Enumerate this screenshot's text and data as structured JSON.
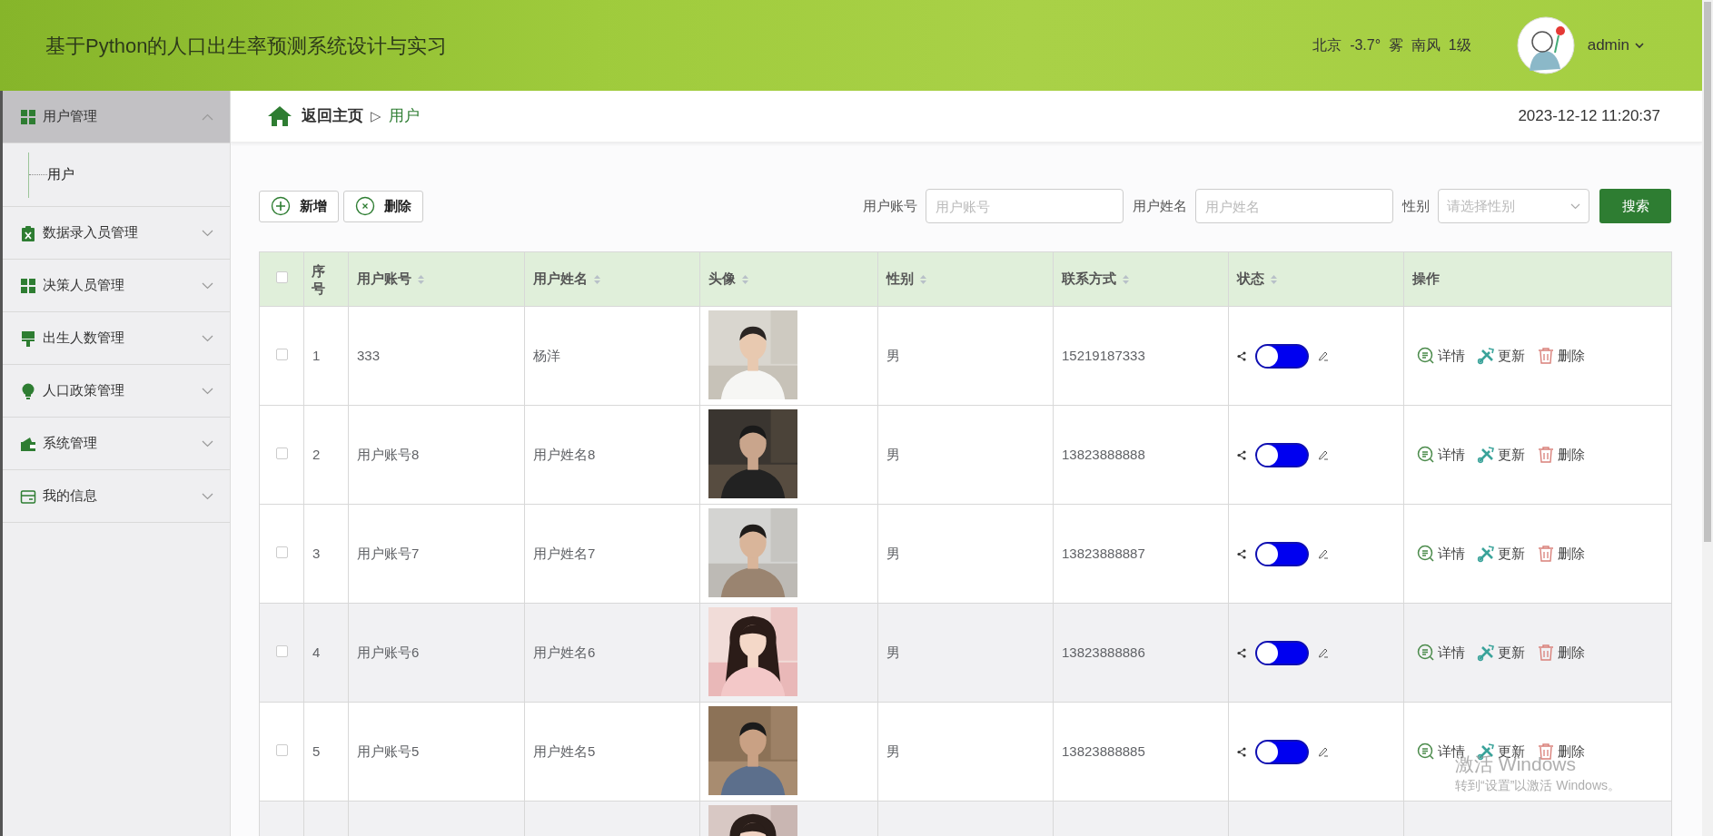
{
  "header": {
    "title": "基于Python的人口出生率预测系统设计与实习",
    "weather": "北京  -3.7°  雾  南风  1级",
    "user": "admin"
  },
  "sidebar": {
    "items": [
      {
        "label": "用户管理",
        "expanded": true,
        "selected": true,
        "children": [
          {
            "label": "用户"
          }
        ]
      },
      {
        "label": "数据录入员管理",
        "expanded": false,
        "selected": false
      },
      {
        "label": "决策人员管理",
        "expanded": false,
        "selected": false
      },
      {
        "label": "出生人数管理",
        "expanded": false,
        "selected": false
      },
      {
        "label": "人口政策管理",
        "expanded": false,
        "selected": false
      },
      {
        "label": "系统管理",
        "expanded": false,
        "selected": false
      },
      {
        "label": "我的信息",
        "expanded": false,
        "selected": false
      }
    ]
  },
  "breadcrumb": {
    "home": "返回主页",
    "separator": "▷",
    "current": "用户"
  },
  "datetime": "2023-12-12 11:20:37",
  "toolbar": {
    "buttons": [
      {
        "label": "新增",
        "kind": "add"
      },
      {
        "label": "删除",
        "kind": "remove"
      }
    ]
  },
  "search": {
    "fields": [
      {
        "label": "用户账号",
        "placeholder": "用户账号",
        "kind": "text"
      },
      {
        "label": "用户姓名",
        "placeholder": "用户姓名",
        "kind": "text"
      },
      {
        "label": "性别",
        "placeholder": "请选择性别",
        "kind": "select"
      }
    ],
    "button": "搜索"
  },
  "table": {
    "select_all": {
      "checked": false
    },
    "columns": [
      {
        "label": "序号",
        "sortable": false
      },
      {
        "label": "用户账号",
        "sortable": true
      },
      {
        "label": "用户姓名",
        "sortable": true
      },
      {
        "label": "头像",
        "sortable": true
      },
      {
        "label": "性别",
        "sortable": true
      },
      {
        "label": "联系方式",
        "sortable": true
      },
      {
        "label": "状态",
        "sortable": true
      },
      {
        "label": "操作",
        "sortable": false
      }
    ],
    "rows": [
      {
        "checked": false,
        "shaded": false,
        "index": "1",
        "account": "333",
        "name": "杨洋",
        "gender": "男",
        "phone": "15219187333",
        "status_on": false,
        "actions": [
          "详情",
          "更新",
          "删除"
        ]
      },
      {
        "checked": false,
        "shaded": false,
        "index": "2",
        "account": "用户账号8",
        "name": "用户姓名8",
        "gender": "男",
        "phone": "13823888888",
        "status_on": false,
        "actions": [
          "详情",
          "更新",
          "删除"
        ]
      },
      {
        "checked": false,
        "shaded": false,
        "index": "3",
        "account": "用户账号7",
        "name": "用户姓名7",
        "gender": "男",
        "phone": "13823888887",
        "status_on": false,
        "actions": [
          "详情",
          "更新",
          "删除"
        ]
      },
      {
        "checked": false,
        "shaded": true,
        "index": "4",
        "account": "用户账号6",
        "name": "用户姓名6",
        "gender": "男",
        "phone": "13823888886",
        "status_on": false,
        "actions": [
          "详情",
          "更新",
          "删除"
        ]
      },
      {
        "checked": false,
        "shaded": false,
        "index": "5",
        "account": "用户账号5",
        "name": "用户姓名5",
        "gender": "男",
        "phone": "13823888885",
        "status_on": false,
        "actions": [
          "详情",
          "更新",
          "删除"
        ]
      },
      {
        "shaded": true
      }
    ]
  },
  "os_notice": {
    "title": "激活 Windows",
    "text": "转到“设置”以激活 Windows。"
  }
}
